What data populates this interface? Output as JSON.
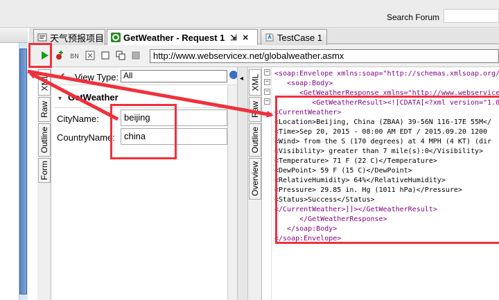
{
  "top": {
    "search_label": "Search Forum"
  },
  "tabs": [
    {
      "label": "天气预报项目"
    },
    {
      "label": "GetWeather - Request 1",
      "controls": [
        "⇲",
        "✕"
      ]
    },
    {
      "label": "TestCase 1"
    }
  ],
  "toolbar": {
    "endpoint": "http://www.webservicex.net/globalweather.asmx"
  },
  "request": {
    "side_tabs": [
      "XML",
      "Raw",
      "Outline",
      "Form"
    ],
    "view_type_label": "View Type:",
    "view_type_value": "All",
    "operation": "GetWeather",
    "fields": [
      {
        "label": "CityName:",
        "value": "beijing"
      },
      {
        "label": "CountryName:",
        "value": "china"
      }
    ]
  },
  "response": {
    "side_tabs": [
      "XML",
      "Raw",
      "Outline",
      "Overview"
    ],
    "xml_lines": [
      "<soap:Envelope xmlns:soap=\"http://schemas.xmlsoap.org/",
      "   <soap:Body>",
      "      <GetWeatherResponse xmlns=\"http://www.webservicex",
      "         <GetWeatherResult><![CDATA[<?xml version=\"1.0",
      "<CurrentWeather>",
      "<Location>Beijing, China (ZBAA) 39-56N 116-17E 55M</",
      "<Time>Sep 20, 2015 - 08:00 AM EDT / 2015.09.20 1200",
      "<Wind> from the S (170 degrees) at 4 MPH (4 KT) (dir",
      "<Visibility> greater than 7 mile(s):0</Visibility>",
      "<Temperature> 71 F (22 C)</Temperature>",
      "<DewPoint> 59 F (15 C)</DewPoint>",
      "<RelativeHumidity> 64%</RelativeHumidity>",
      "<Pressure> 29.85 in. Hg (1011 hPa)</Pressure>",
      "<Status>Success</Status>",
      "</CurrentWeather>]]></GetWeatherResult>",
      "      </GetWeatherResponse>",
      "   </soap:Body>",
      "</soap:Envelope>"
    ]
  },
  "colors": {
    "annotation": "#f0303b",
    "xml_tag": "#7f007f",
    "xml_value": "#2a00ff",
    "run_icon": "#1a9a1a"
  }
}
